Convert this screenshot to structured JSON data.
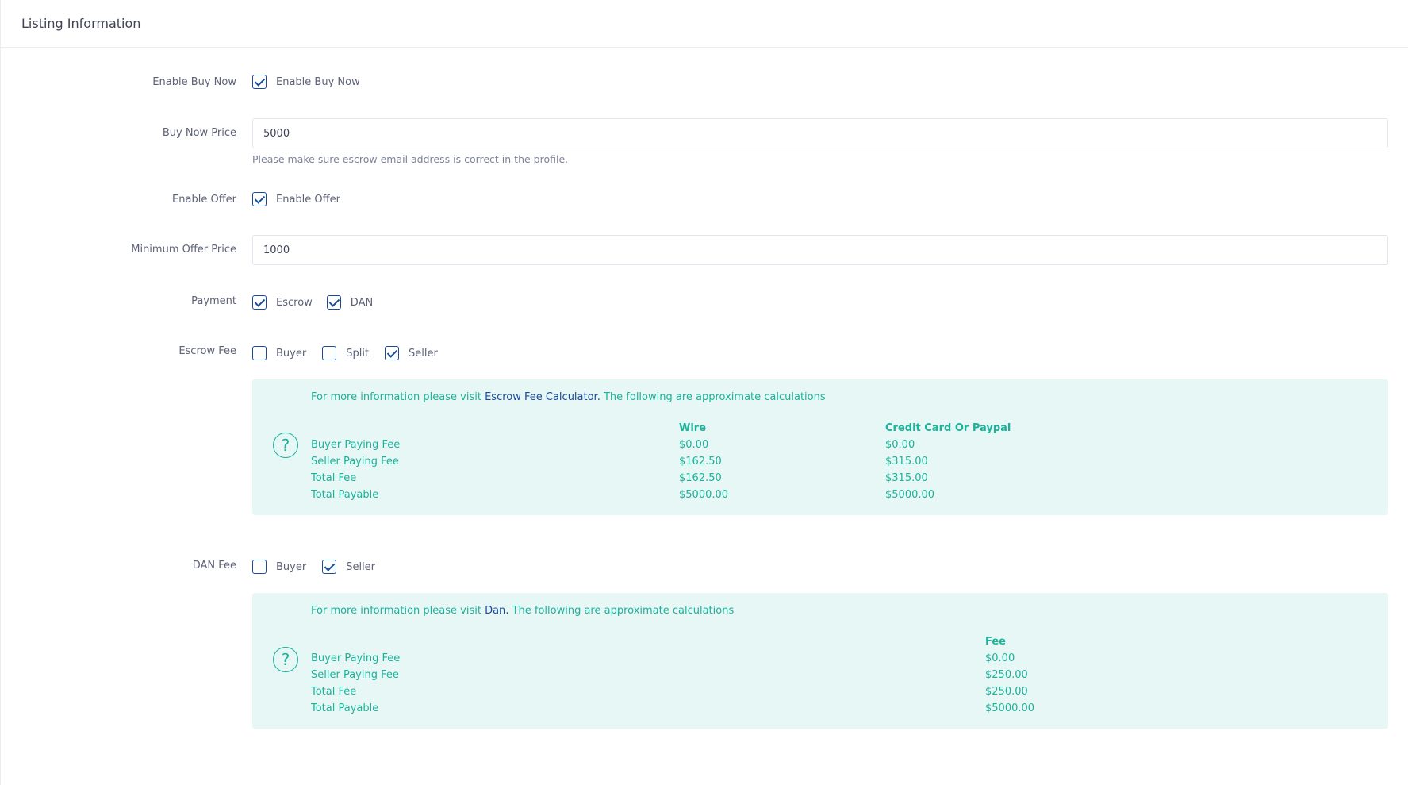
{
  "header": {
    "title": "Listing Information"
  },
  "enable_buy_now": {
    "label": "Enable Buy Now",
    "option_label": "Enable Buy Now",
    "checked": true
  },
  "buy_now_price": {
    "label": "Buy Now Price",
    "value": "5000",
    "hint": "Please make sure escrow email address is correct in the profile."
  },
  "enable_offer": {
    "label": "Enable Offer",
    "option_label": "Enable Offer",
    "checked": true
  },
  "minimum_offer_price": {
    "label": "Minimum Offer Price",
    "value": "1000"
  },
  "payment": {
    "label": "Payment",
    "options": [
      {
        "label": "Escrow",
        "checked": true
      },
      {
        "label": "DAN",
        "checked": true
      }
    ]
  },
  "escrow_fee": {
    "label": "Escrow Fee",
    "options": [
      {
        "label": "Buyer",
        "checked": false
      },
      {
        "label": "Split",
        "checked": false
      },
      {
        "label": "Seller",
        "checked": true
      }
    ],
    "info": {
      "prefix": "For more information please visit ",
      "link": "Escrow Fee Calculator.",
      "suffix": " The following are approximate calculations",
      "columns": [
        "Wire",
        "Credit Card Or Paypal"
      ],
      "rows": [
        {
          "label": "Buyer Paying Fee",
          "values": [
            "$0.00",
            "$0.00"
          ]
        },
        {
          "label": "Seller Paying Fee",
          "values": [
            "$162.50",
            "$315.00"
          ]
        },
        {
          "label": "Total Fee",
          "values": [
            "$162.50",
            "$315.00"
          ]
        },
        {
          "label": "Total Payable",
          "values": [
            "$5000.00",
            "$5000.00"
          ]
        }
      ]
    }
  },
  "dan_fee": {
    "label": "DAN Fee",
    "options": [
      {
        "label": "Buyer",
        "checked": false
      },
      {
        "label": "Seller",
        "checked": true
      }
    ],
    "info": {
      "prefix": "For more information please visit ",
      "link": "Dan.",
      "suffix": " The following are approximate calculations",
      "columns": [
        "Fee"
      ],
      "rows": [
        {
          "label": "Buyer Paying Fee",
          "values": [
            "$0.00"
          ]
        },
        {
          "label": "Seller Paying Fee",
          "values": [
            "$250.00"
          ]
        },
        {
          "label": "Total Fee",
          "values": [
            "$250.00"
          ]
        },
        {
          "label": "Total Payable",
          "values": [
            "$5000.00"
          ]
        }
      ]
    }
  },
  "icons": {
    "info": "question-circle-icon",
    "check": "checkmark-icon"
  },
  "colors": {
    "accent": "#1a4b9b",
    "info_text": "#1bb39a",
    "info_bg": "#e6f7f5"
  }
}
